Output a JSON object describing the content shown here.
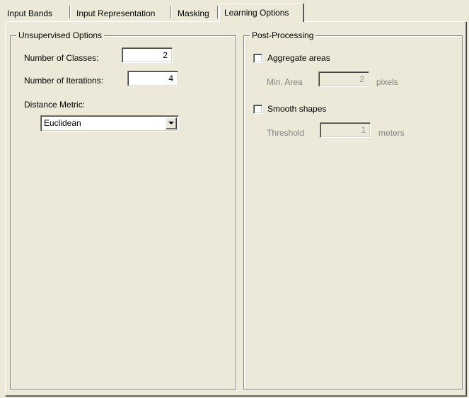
{
  "tabs": [
    {
      "label": "Input Bands",
      "active": false
    },
    {
      "label": "Input Representation",
      "active": false
    },
    {
      "label": "Masking",
      "active": false
    },
    {
      "label": "Learning Options",
      "active": true
    }
  ],
  "unsupervised": {
    "title": "Unsupervised Options",
    "classes_label": "Number of Classes:",
    "classes_value": "2",
    "iterations_label": "Number of Iterations:",
    "iterations_value": "4",
    "metric_label": "Distance Metric:",
    "metric_value": "Euclidean"
  },
  "postprocessing": {
    "title": "Post-Processing",
    "aggregate_label": "Aggregate areas",
    "aggregate_checked": false,
    "min_area_label": "Min. Area",
    "min_area_value": "2",
    "min_area_unit": "pixels",
    "smooth_label": "Smooth shapes",
    "smooth_checked": false,
    "threshold_label": "Threshold",
    "threshold_value": "1",
    "threshold_unit": "meters"
  }
}
